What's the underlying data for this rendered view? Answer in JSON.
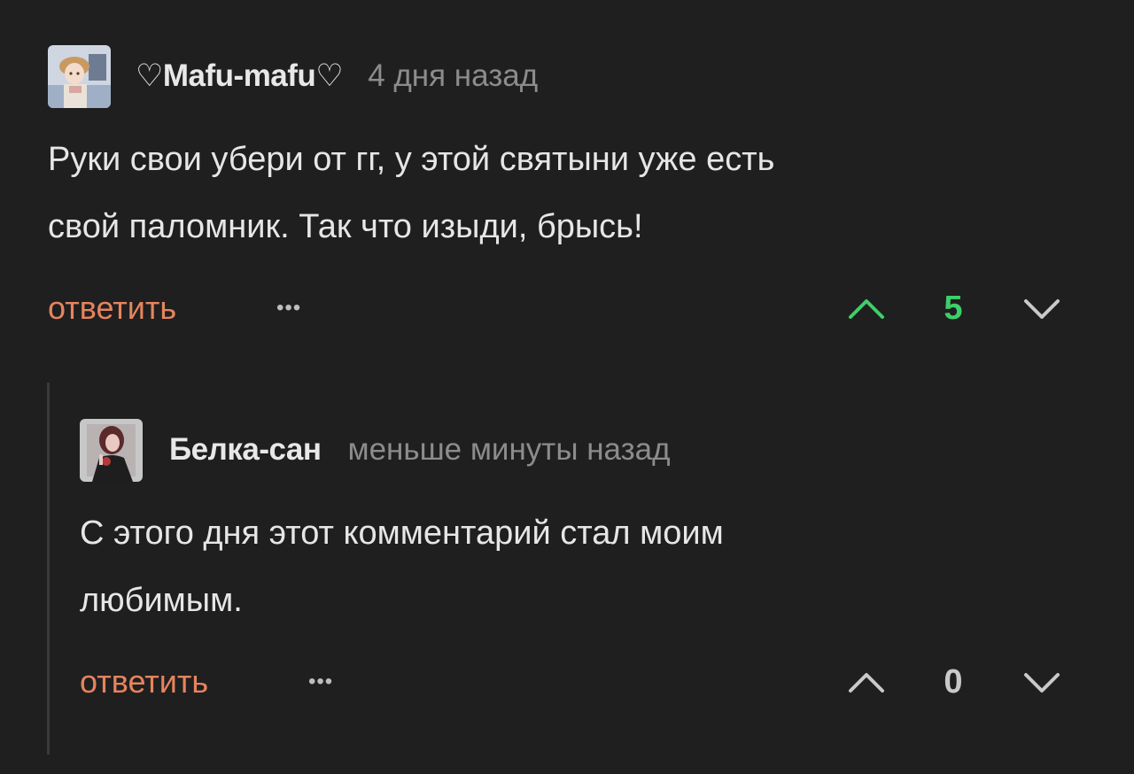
{
  "comments": [
    {
      "author": "♡Mafu-mafu♡",
      "time": "4 дня назад",
      "text": "Руки свои убери от гг, у этой святыни уже есть\nсвой паломник. Так что изыди, брысь!",
      "reply_label": "ответить",
      "more_label": "•••",
      "score": "5",
      "score_color": "#3ecf6a",
      "upvote_color": "#3ecf6a",
      "downvote_color": "#c9c9c9",
      "avatar_icon": "avatar-illustrated-user-icon"
    },
    {
      "author": "Белка-сан",
      "time": "меньше минуты назад",
      "text": "С этого дня этот комментарий стал моим\nлюбимым.",
      "reply_label": "ответить",
      "more_label": "•••",
      "score": "0",
      "score_color": "#c9c9c9",
      "upvote_color": "#c9c9c9",
      "downvote_color": "#c9c9c9",
      "avatar_icon": "avatar-illustrated-user-icon"
    }
  ],
  "colors": {
    "background": "#1f1f1f",
    "reply_link": "#e6845e",
    "thread_line": "#3a3a3a"
  }
}
